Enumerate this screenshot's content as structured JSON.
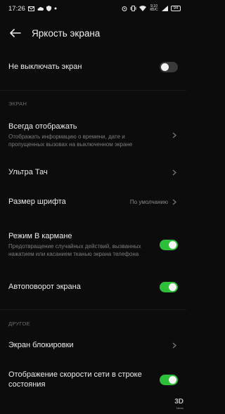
{
  "status_bar": {
    "time": "17:26",
    "speed": "9,10\nКБ/С",
    "battery": "94",
    "icons": [
      "gmail-icon",
      "cloud-icon",
      "shield-icon",
      "dot-icon",
      "alarm-icon",
      "vibrate-icon",
      "wifi-icon",
      "signal-icon",
      "battery-icon"
    ]
  },
  "header": {
    "title": "Яркость экрана"
  },
  "items": {
    "keep_screen_on": {
      "title": "Не выключать экран",
      "on": false
    },
    "section_screen": "ЭКРАН",
    "always_on": {
      "title": "Всегда отображать",
      "subtitle": "Отображать информацию о времени, дате и пропущенных вызовах на выключенном экране"
    },
    "ultra_touch": {
      "title": "Ультра Тач"
    },
    "font_size": {
      "title": "Размер шрифта",
      "value": "По умолчанию"
    },
    "pocket_mode": {
      "title": "Режим В кармане",
      "subtitle": "Предотвращение случайных действий, вызванных нажатием или касанием тканью экрана телефона",
      "on": true
    },
    "auto_rotate": {
      "title": "Автоповорот экрана",
      "on": true
    },
    "section_other": "ДРУГОЕ",
    "lock_screen": {
      "title": "Экран блокировки"
    },
    "net_speed": {
      "title": "Отображение скорости сети в строке состояния",
      "on": true
    }
  },
  "watermark": {
    "text": "3D",
    "sub": "News"
  },
  "colors": {
    "accent": "#2dbe3a",
    "background": "#0c0c0c"
  }
}
